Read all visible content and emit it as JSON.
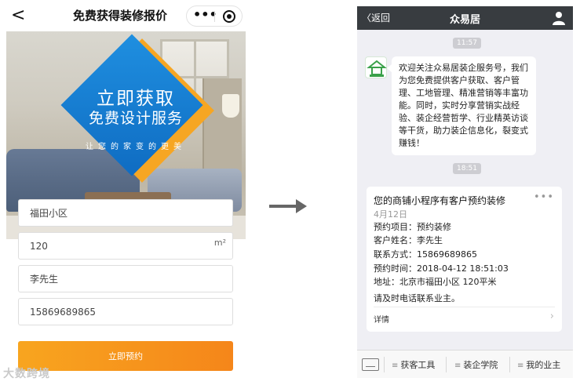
{
  "left": {
    "nav": {
      "back_glyph": "<",
      "title": "免费获得装修报价",
      "more_glyph": "•••"
    },
    "banner": {
      "line1": "立即获取",
      "line2": "免费设计服务",
      "slogan": "让您的家变的更美"
    },
    "form": {
      "community": "福田小区",
      "area": "120",
      "area_unit": "m²",
      "name": "李先生",
      "phone": "15869689865",
      "submit_label": "立即预约"
    },
    "watermark": "大数跨境"
  },
  "right": {
    "nav": {
      "back_label": "〈返回",
      "title": "众易居"
    },
    "time1": "11:57",
    "welcome": "欢迎关注众易居装企服务号，我们为您免费提供客户获取、客户管理、工地管理、精准营销等丰富功能。同时，实时分享营销实战经验、装企经营哲学、行业精英访谈等干货，助力装企信息化，裂变式赚钱！",
    "time2": "18:51",
    "card": {
      "title": "您的商铺小程序有客户预约装修",
      "more_glyph": "•••",
      "date": "4月12日",
      "lines": [
        "预约项目：预约装修",
        "客户姓名：李先生",
        "联系方式：15869689865",
        "预约时间：2018-04-12 18:51:03",
        "地址：北京市福田小区 120平米",
        "请及时电话联系业主。"
      ],
      "detail_label": "详情",
      "chevron": "›"
    },
    "menu": {
      "items": [
        "获客工具",
        "装企学院",
        "我的业主"
      ],
      "bar_glyph": "≡"
    }
  },
  "colors": {
    "accent_orange": "#f5861a",
    "banner_blue": "#1f8fe0",
    "wechat_nav": "#383c40"
  }
}
